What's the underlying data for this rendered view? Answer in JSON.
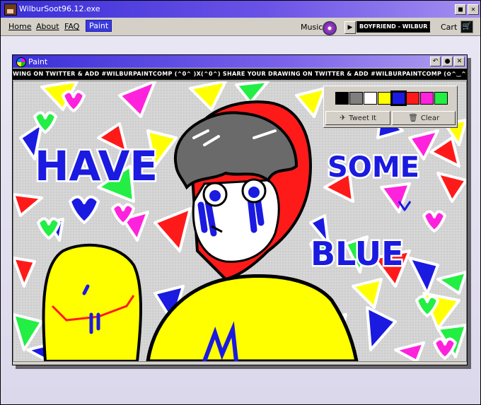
{
  "window": {
    "title": "WilburSoot96.12.exe",
    "buttons": [
      "■",
      "✕"
    ]
  },
  "menu": {
    "items": [
      "Home",
      "About",
      "FAQ",
      "Paint"
    ],
    "active": "Paint"
  },
  "music": {
    "label": "Music",
    "play_symbol": "▶",
    "now_playing": "BOYFRIEND - WILBUR SOOT"
  },
  "cart": {
    "label": "Cart",
    "icon": "cart-icon"
  },
  "paint": {
    "title": "Paint",
    "controls": [
      "↶",
      "●",
      "✕"
    ],
    "ticker": "WING ON TWITTER & ADD #WILBURPAINTCOMP (^0^ )X(^0^) SHARE YOUR DRAWING ON TWITTER & ADD #WILBURPAINTCOMP (✿^‿^) SHARE YOUR DRAWING ON TWITTE",
    "palette_colors": [
      "#000000",
      "#7f7f7f",
      "#ffffff",
      "#ffff00",
      "#1a1ae0",
      "#ff1a1a",
      "#ff22dd",
      "#22ee44"
    ],
    "tweet_label": "Tweet It",
    "clear_label": "Clear",
    "drawing_text": [
      "HAVE",
      "SOME",
      "BLUE"
    ]
  },
  "colors": {
    "title_gradient_start": "#3a2fd8",
    "title_gradient_end": "#a48ff0",
    "chrome": "#d4d0c8",
    "active_menu": "#3a3ae0"
  }
}
